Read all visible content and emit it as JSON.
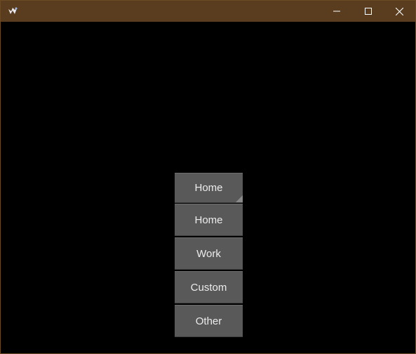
{
  "window": {
    "icon": "kivy-app-icon",
    "controls": {
      "minimize_icon": "minimize-icon",
      "maximize_icon": "maximize-icon",
      "close_icon": "close-icon"
    },
    "colors": {
      "titlebar": "#5a3d1e",
      "background": "#000000",
      "button": "#595959",
      "text": "#ececec"
    }
  },
  "dropdown": {
    "main_button_label": "Home",
    "options": [
      {
        "label": "Home"
      },
      {
        "label": "Work"
      },
      {
        "label": "Custom"
      },
      {
        "label": "Other"
      }
    ]
  }
}
